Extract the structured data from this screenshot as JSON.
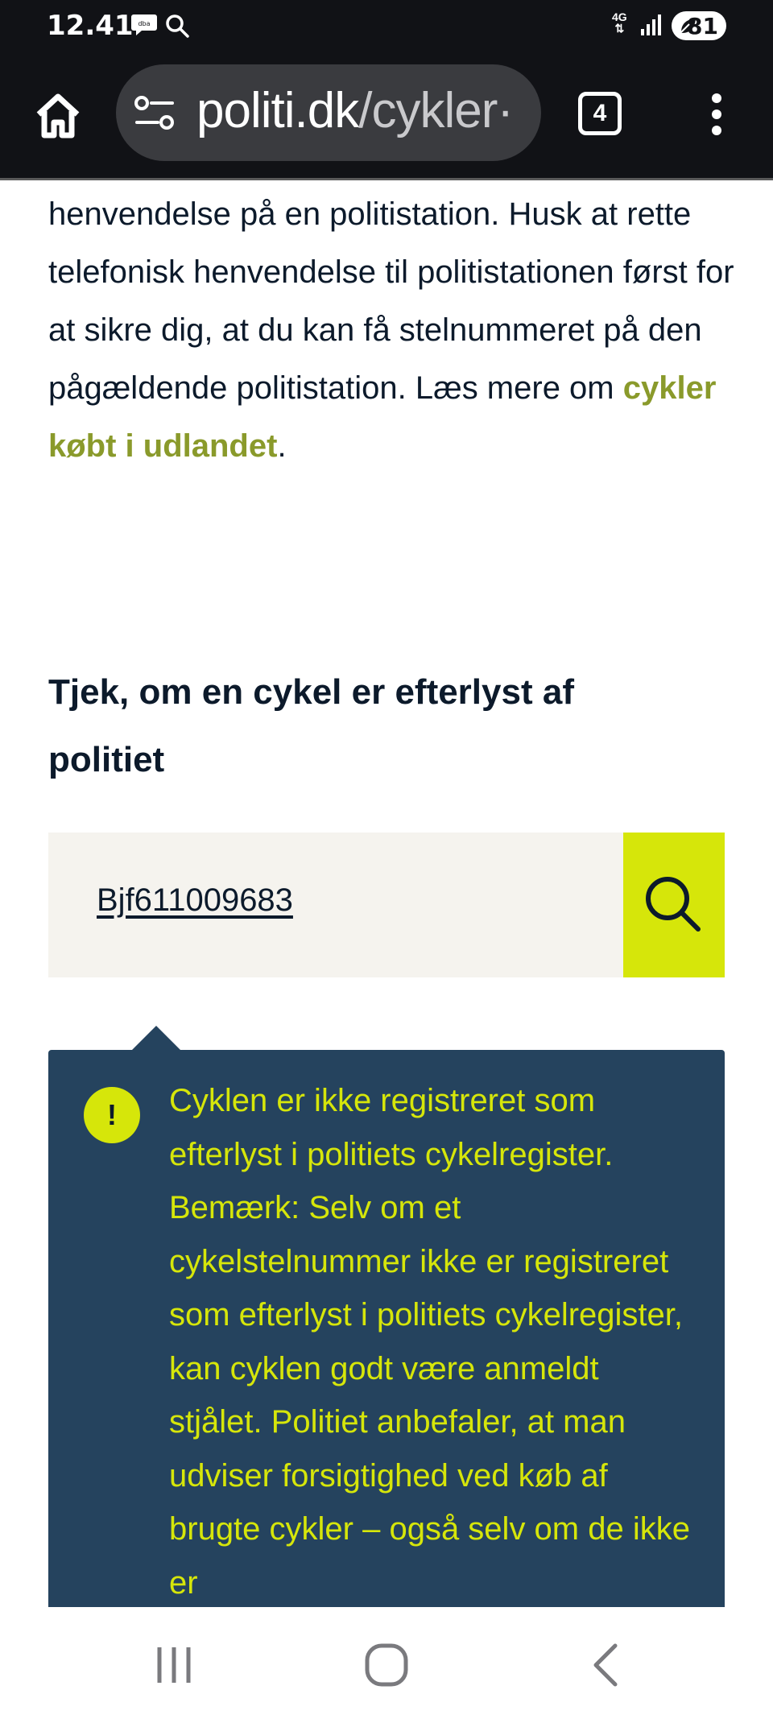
{
  "status_bar": {
    "time": "12.41",
    "network": "4G",
    "battery": "81"
  },
  "browser": {
    "url_domain": "politi.dk",
    "url_path": "/cykler·",
    "tab_count": "4"
  },
  "page": {
    "intro_text": "henvendelse på en politistation. Husk at rette telefonisk henvendelse til politistationen først for at sikre dig, at du kan få stelnummeret på den pågældende politistation. Læs mere om ",
    "intro_link": "cykler købt i udlandet",
    "intro_end": ".",
    "heading": "Tjek, om en cykel er efterlyst af politiet",
    "search_value": "Bjf611009683",
    "alert_icon": "!",
    "alert_text": "Cyklen er ikke registreret som efterlyst i politiets cykelregister. Bemærk: Selv om et cykelstelnummer ikke er registreret som efterlyst i politiets cykelregister, kan cyklen godt være anmeldt stjålet. Politiet anbefaler, at man udviser forsigtighed ved køb af brugte cykler – også selv om de ikke er"
  },
  "colors": {
    "accent": "#d6e60a",
    "alert_bg": "#25435e",
    "link": "#8a9a2b",
    "text": "#0c1a2b",
    "search_bg": "#f5f3ee",
    "toolbar_bg": "#111216"
  },
  "icons": {
    "home": "home-icon",
    "site_settings": "site-settings-icon",
    "menu": "more-vertical-icon",
    "search": "search-icon",
    "recent_apps": "recent-apps-icon",
    "home_nav": "home-nav-icon",
    "back": "back-icon"
  }
}
